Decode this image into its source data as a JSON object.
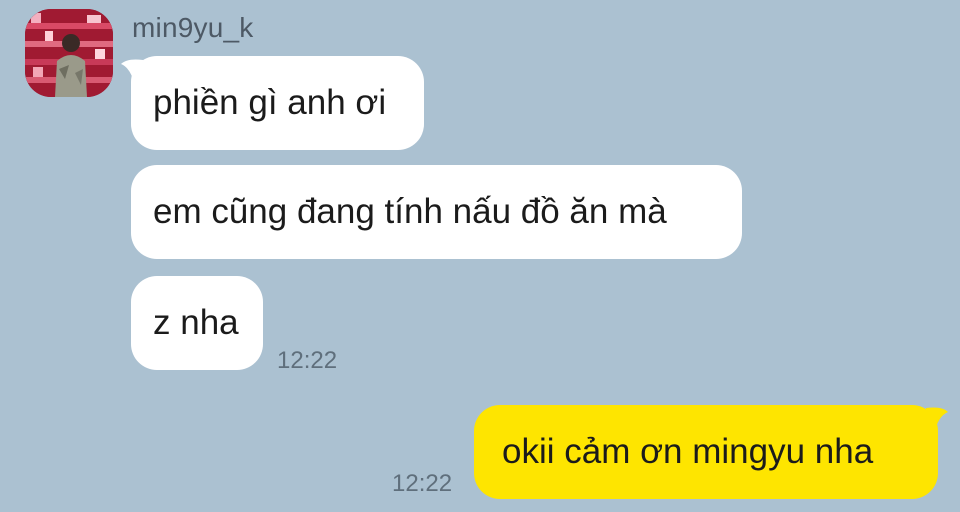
{
  "conversation": {
    "sender": {
      "name": "min9yu_k",
      "avatar_icon": "profile-photo"
    },
    "messages": [
      {
        "side": "incoming",
        "text": "phiền gì anh ơi"
      },
      {
        "side": "incoming",
        "text": "em cũng đang tính nấu đồ ăn mà"
      },
      {
        "side": "incoming",
        "text": "z nha",
        "time": "12:22"
      },
      {
        "side": "outgoing",
        "text": "okii cảm ơn mingyu nha",
        "time": "12:22"
      }
    ]
  },
  "colors": {
    "background": "#abc1d1",
    "incoming_bubble": "#ffffff",
    "outgoing_bubble": "#fee500",
    "timestamp": "#5f6f7c"
  }
}
